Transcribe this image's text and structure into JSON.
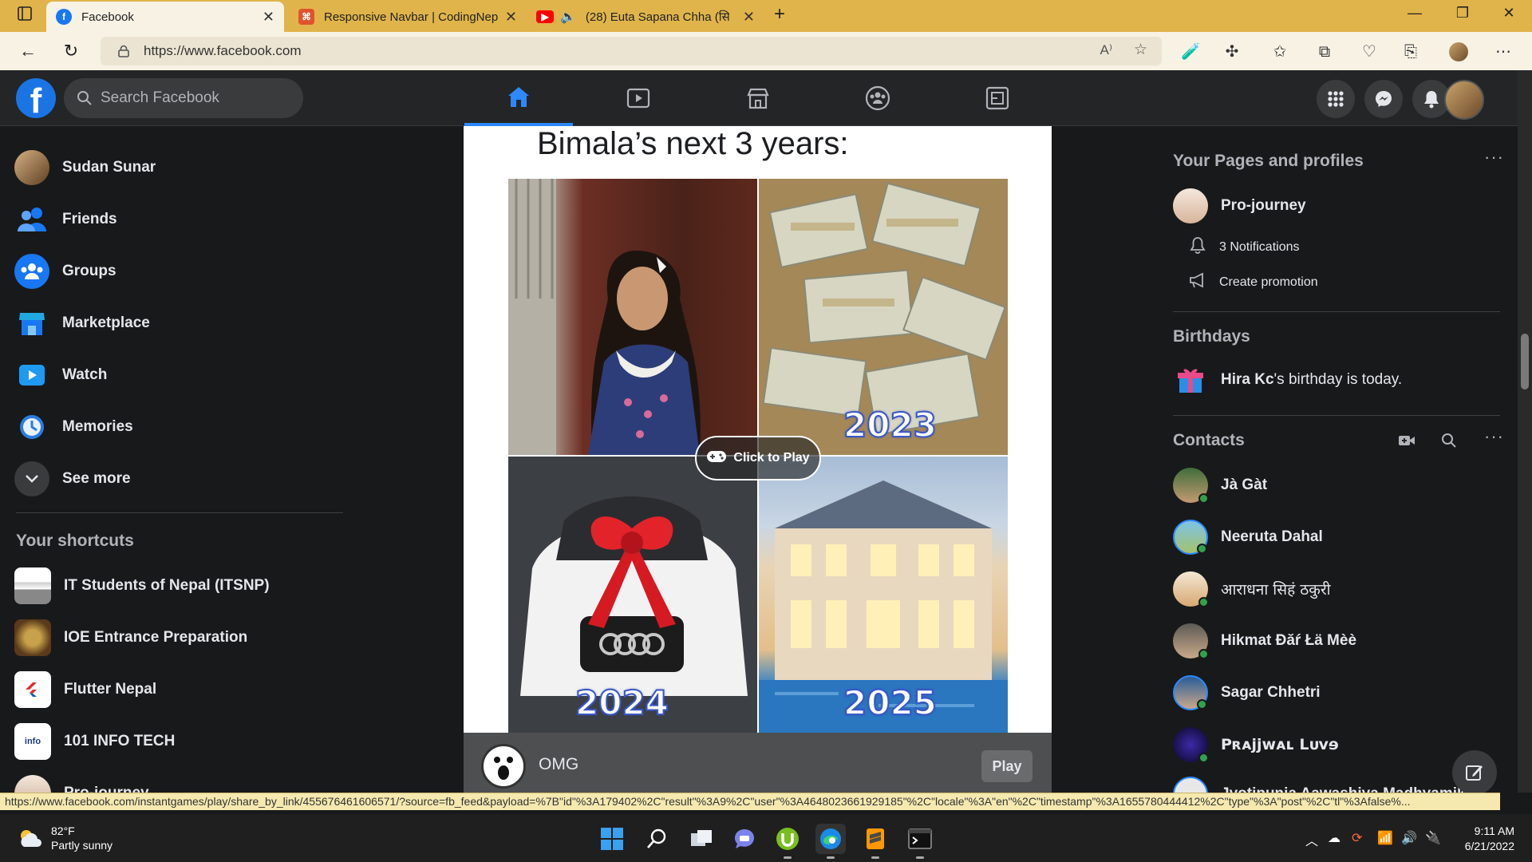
{
  "browser": {
    "tabs": [
      {
        "title": "Facebook",
        "active": true
      },
      {
        "title": "Responsive Navbar | CodingNep",
        "active": false
      },
      {
        "title": "(28) Euta Sapana Chha (सिरा",
        "active": false
      }
    ],
    "new_tab": "+",
    "url": "https://www.facebook.com",
    "status_url": "https://www.facebook.com/instantgames/play/share_by_link/455676461606571/?source=fb_feed&payload=%7B\"id\"%3A179402%2C\"result\"%3A9%2C\"user\"%3A4648023661929185\"%2C\"locale\"%3A\"en\"%2C\"timestamp\"%3A1655780444412%2C\"type\"%3A\"post\"%2C\"tl\"%3Afalse%..."
  },
  "fb": {
    "search_placeholder": "Search Facebook",
    "left": {
      "items": [
        {
          "label": "Sudan Sunar"
        },
        {
          "label": "Friends"
        },
        {
          "label": "Groups"
        },
        {
          "label": "Marketplace"
        },
        {
          "label": "Watch"
        },
        {
          "label": "Memories"
        },
        {
          "label": "See more"
        }
      ],
      "shortcuts_title": "Your shortcuts",
      "shortcuts": [
        {
          "label": "IT Students of Nepal (ITSNP)"
        },
        {
          "label": "IOE Entrance Preparation"
        },
        {
          "label": "Flutter Nepal"
        },
        {
          "label": "101 INFO TECH"
        },
        {
          "label": "Pro-journey"
        }
      ]
    },
    "post": {
      "title": "Bimala’s next 3 years:",
      "years": [
        "2023",
        "2024",
        "2025"
      ],
      "click_to_play": "Click to Play",
      "game_name": "OMG",
      "play_label": "Play"
    },
    "right": {
      "pages_title": "Your Pages and profiles",
      "page_name": "Pro-journey",
      "notifications": "3 Notifications",
      "create_promotion": "Create promotion",
      "birthdays_title": "Birthdays",
      "birthday_name": "Hira Kc",
      "birthday_rest": "'s birthday is today.",
      "contacts_title": "Contacts",
      "contacts": [
        {
          "name": "Jà Gàt"
        },
        {
          "name": "Neeruta Dahal"
        },
        {
          "name": "आराधना सिहं ठकुरी"
        },
        {
          "name": "Hikmat Đăŕ Łä Mèè"
        },
        {
          "name": "Sagar Chhetri"
        },
        {
          "name": "Pʀᴀjjwᴀʟ Lᴜvɘ"
        },
        {
          "name": "Jyotipunja Aawashiya Madhyamik"
        }
      ]
    }
  },
  "taskbar": {
    "temp": "82°F",
    "weather": "Partly sunny",
    "time": "9:11 AM",
    "date": "6/21/2022"
  },
  "colors": {
    "accent": "#2d88ff",
    "tabbar": "#e0b44a",
    "online": "#31a24c"
  }
}
